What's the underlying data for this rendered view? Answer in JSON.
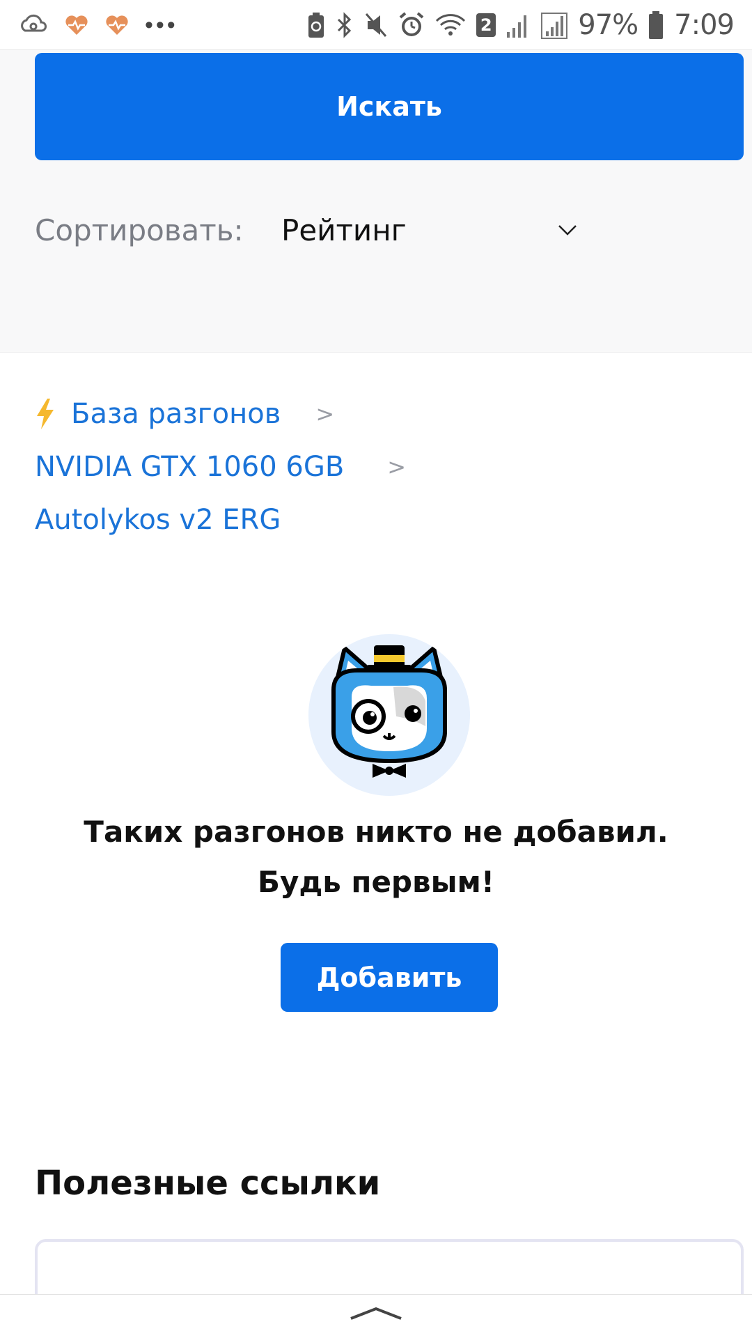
{
  "status_bar": {
    "battery_percent": "97%",
    "time": "7:09",
    "sim_badge": "2",
    "left_icons": [
      "cloud-sync-icon",
      "heart-rate-icon",
      "heart-rate-icon",
      "more-dots-icon"
    ],
    "right_icons": [
      "battery-saver-icon",
      "bluetooth-icon",
      "mute-icon",
      "alarm-icon",
      "wifi-icon",
      "signal-icon",
      "signal-icon",
      "battery-icon"
    ]
  },
  "filters": {
    "search_button": "Искать",
    "sort_label": "Сортировать:",
    "sort_value": "Рейтинг"
  },
  "breadcrumbs": {
    "items": [
      {
        "label": "База разгонов"
      },
      {
        "label": "NVIDIA GTX 1060 6GB"
      },
      {
        "label": "Autolykos v2 ERG"
      }
    ],
    "separator": ">"
  },
  "empty_state": {
    "message": "Таких разгонов никто не добавил. Будь первым!",
    "add_button": "Добавить"
  },
  "useful_links": {
    "title": "Полезные ссылки"
  },
  "colors": {
    "primary": "#0b6fe8",
    "link": "#1a73d8",
    "panel_bg": "#f8f8f9",
    "muted_text": "#7a7d85"
  }
}
